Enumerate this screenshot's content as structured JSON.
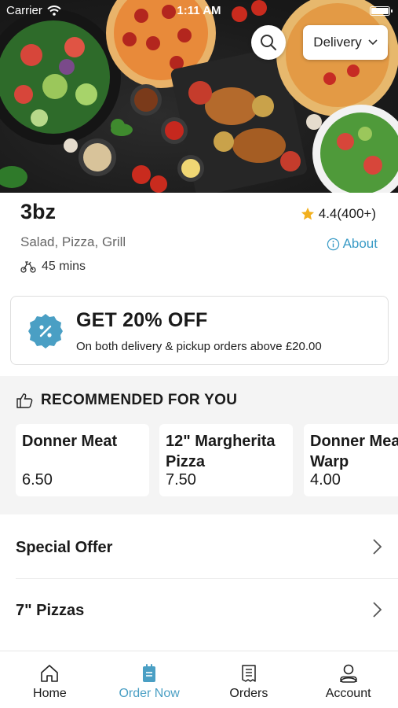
{
  "status_bar": {
    "carrier": "Carrier",
    "time": "1:11 AM"
  },
  "header": {
    "delivery_mode": "Delivery"
  },
  "restaurant": {
    "name": "3bz",
    "rating": "4.4(400+)",
    "cuisines": "Salad, Pizza, Grill",
    "about_label": "About",
    "delivery_time": "45 mins"
  },
  "promo": {
    "title": "GET 20% OFF",
    "subtitle": "On both delivery & pickup orders above £20.00"
  },
  "recommended": {
    "title": "RECOMMENDED FOR YOU",
    "items": [
      {
        "name": "Donner Meat",
        "price": "6.50"
      },
      {
        "name": "12\" Margherita Pizza",
        "price": "7.50"
      },
      {
        "name": "Donner Meat Warp",
        "price": "4.00"
      }
    ]
  },
  "categories": [
    {
      "label": "Special Offer"
    },
    {
      "label": "7\" Pizzas"
    }
  ],
  "tabs": [
    {
      "label": "Home",
      "icon": "home-icon"
    },
    {
      "label": "Order Now",
      "icon": "order-icon"
    },
    {
      "label": "Orders",
      "icon": "receipt-icon"
    },
    {
      "label": "Account",
      "icon": "person-icon"
    }
  ],
  "colors": {
    "accent": "#4a9fc4",
    "link": "#3a9bc6",
    "star": "#f2b01e",
    "badge": "#4a9fc4"
  }
}
